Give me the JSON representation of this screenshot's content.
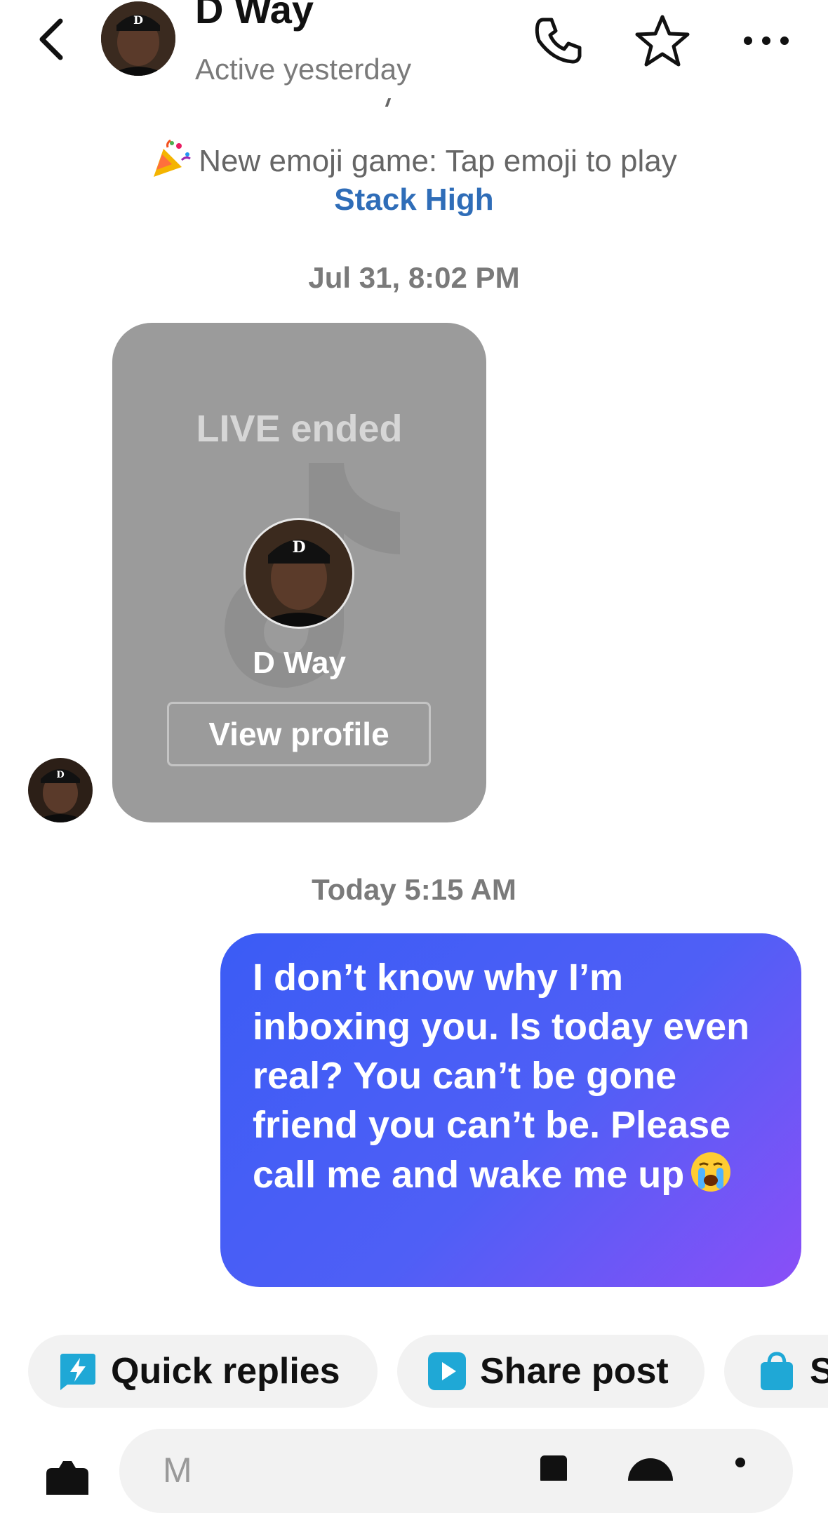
{
  "header": {
    "contact_name": "D Way",
    "status": "Active yesterday",
    "back_icon": "chevron-left-icon",
    "call_icon": "phone-icon",
    "favorite_icon": "star-icon",
    "more_icon": "ellipsis-icon"
  },
  "notice": {
    "emoji": "party-popper-icon",
    "text": "New emoji game: Tap emoji to play",
    "link": "Stack High",
    "link_color": "#2f6db8"
  },
  "messages": {
    "timestamp_1": "Jul 31, 8:02 PM",
    "live_card": {
      "status": "LIVE ended",
      "name": "D Way",
      "button": "View profile"
    },
    "timestamp_2": "Today 5:15 AM",
    "outgoing_text": "I don’t know why I’m inboxing you. Is today even real? You can’t be gone friend you can’t be. Please call me and wake me up",
    "outgoing_emoji": "loudly-crying-face-icon",
    "bubble_colors": [
      "#3b5cf5",
      "#8a4ff7"
    ]
  },
  "quick_actions": {
    "quick_replies": "Quick replies",
    "share_post": "Share post",
    "third_partial": "S"
  },
  "composer": {
    "placeholder": "M"
  }
}
